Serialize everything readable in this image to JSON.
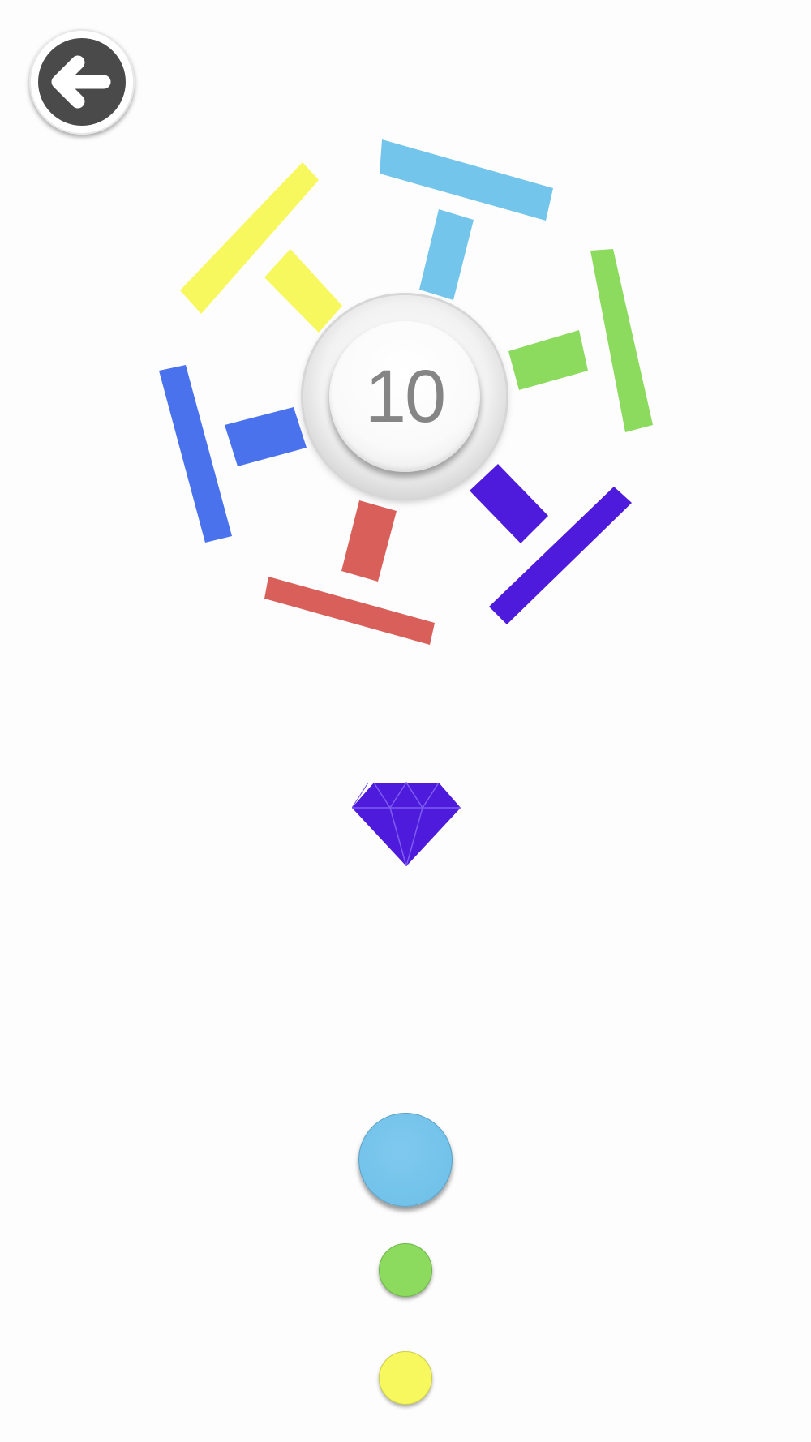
{
  "header": {
    "back_icon": "arrow-left-icon"
  },
  "hub": {
    "score": "10"
  },
  "wheel": {
    "segments": [
      {
        "name": "segment-yellow",
        "color": "#f7f75e"
      },
      {
        "name": "segment-sky-blue",
        "color": "#74c5ec"
      },
      {
        "name": "segment-green",
        "color": "#8cdb5f"
      },
      {
        "name": "segment-purple",
        "color": "#4e1bdc"
      },
      {
        "name": "segment-red",
        "color": "#d9605a"
      },
      {
        "name": "segment-blue",
        "color": "#4a72ec"
      }
    ]
  },
  "gem": {
    "icon": "diamond-icon",
    "color": "#4e1bdc"
  },
  "queue": {
    "balls": [
      {
        "color": "#74c5ec"
      },
      {
        "color": "#8cdb5f"
      },
      {
        "color": "#f7f75e"
      }
    ]
  }
}
